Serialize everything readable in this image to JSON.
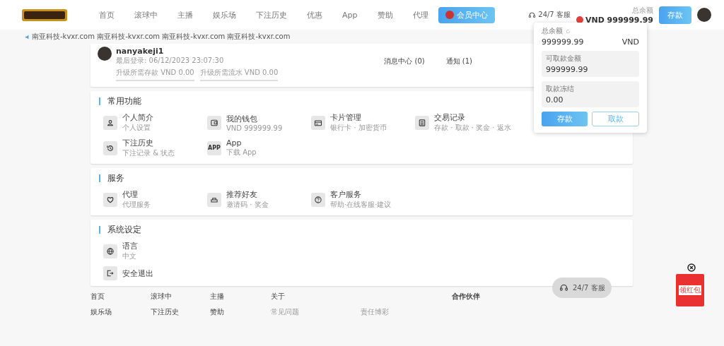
{
  "nav": {
    "items": [
      {
        "label": "首页",
        "selected": false
      },
      {
        "label": "滚球中",
        "selected": false
      },
      {
        "label": "主播",
        "selected": false
      },
      {
        "label": "娱乐场",
        "selected": false
      },
      {
        "label": "下注历史",
        "selected": false
      },
      {
        "label": "优惠",
        "selected": false
      },
      {
        "label": "App",
        "selected": false
      },
      {
        "label": "赞助",
        "selected": false
      },
      {
        "label": "代理",
        "selected": false
      },
      {
        "label": "会员中心",
        "selected": true
      }
    ]
  },
  "header": {
    "support": "24/7 客服",
    "balance_label": "总余额",
    "balance": "VND 999999.99",
    "deposit": "存款"
  },
  "marquee": "南亚科技-kvxr.com 南亚科技-kvxr.com 南亚科技-kvxr.com 南亚科技-kvxr.com",
  "profile": {
    "username": "nanyakeji1",
    "last_login": "最后登录: 06/12/2023 23:07:30",
    "upgrade_deposit": "升级所需存款 VND 0.00",
    "upgrade_turnover": "升级所需流水 VND 0.00",
    "messages": "消息中心 (0)",
    "notices": "通知 (1)"
  },
  "sections": [
    {
      "title": "常用功能",
      "items": [
        {
          "label": "个人简介",
          "sub": "个人设置"
        },
        {
          "label": "我的钱包",
          "sub": "VND 999999.99"
        },
        {
          "label": "卡片管理",
          "sub": "银行卡 · 加密货币"
        },
        {
          "label": "交易记录",
          "sub": "存款 · 取款 · 奖金 · 返水"
        },
        {
          "label": "下注历史",
          "sub": "下注记录 & 状态"
        },
        {
          "label": "App",
          "sub": "下载 App",
          "icon_text": "APP"
        }
      ]
    },
    {
      "title": "服务",
      "items": [
        {
          "label": "代理",
          "sub": "代理服务"
        },
        {
          "label": "推荐好友",
          "sub": "邀请码 · 奖金"
        },
        {
          "label": "客户服务",
          "sub": "帮助·在线客服·建议"
        }
      ]
    },
    {
      "title": "系统设定",
      "items": [
        {
          "label": "语言",
          "sub": "中文"
        },
        {
          "label": "安全退出"
        }
      ]
    }
  ],
  "floating_support": "24/7 客服",
  "red_envelope": "领红包",
  "balance_popup": {
    "total_label": "总余额",
    "total": "999999.99",
    "currency": "VND",
    "withdrawable_label": "可取款金额",
    "withdrawable": "999999.99",
    "frozen_label": "取款冻结",
    "frozen": "0.00",
    "deposit": "存款",
    "withdraw": "取款"
  },
  "footer": {
    "columns": [
      {
        "heading": "首页",
        "links": [
          "娱乐场"
        ]
      },
      {
        "heading": "滚球中",
        "links": [
          "下注历史"
        ]
      },
      {
        "heading": "主播",
        "links": [
          "赞助"
        ]
      },
      {
        "heading": "关于",
        "links": [
          "常见问题"
        ]
      },
      {
        "links": [
          "责任博彩"
        ]
      },
      {
        "heading": "合作伙伴"
      }
    ]
  }
}
